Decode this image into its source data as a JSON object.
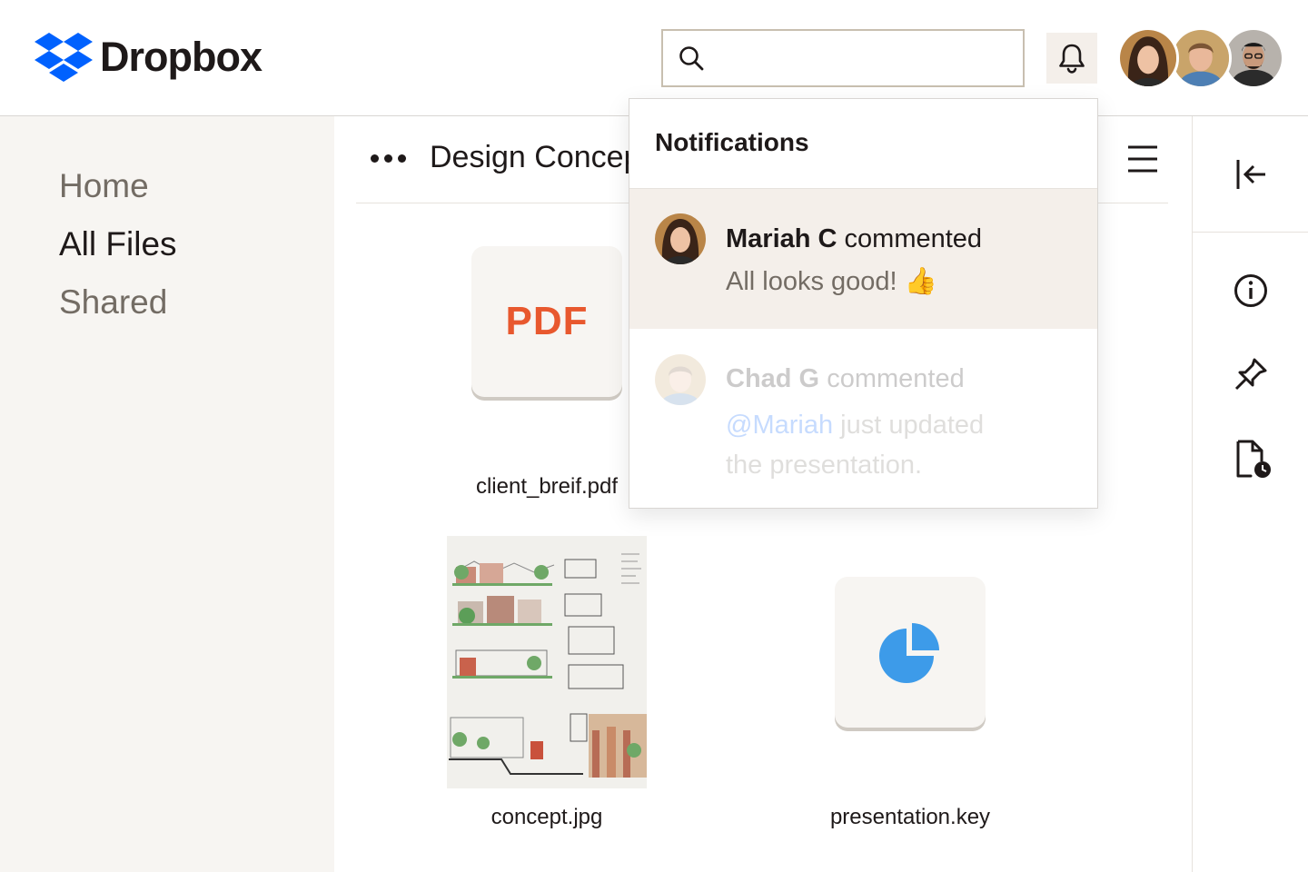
{
  "brand": {
    "name": "Dropbox",
    "color": "#0061fe"
  },
  "search": {
    "placeholder": "",
    "value": ""
  },
  "header": {
    "bell_icon": "bell-icon",
    "avatars": [
      "Mariah",
      "Chad",
      "Third user"
    ]
  },
  "sidebar": {
    "items": [
      {
        "label": "Home",
        "active": false
      },
      {
        "label": "All Files",
        "active": true
      },
      {
        "label": "Shared",
        "active": false
      }
    ]
  },
  "main": {
    "breadcrumb": "Design Concep",
    "files": [
      {
        "name": "client_breif.pdf",
        "type_label": "PDF",
        "type_color": "#e8582e"
      },
      {
        "name": "concept.jpg"
      },
      {
        "name": "presentation.key",
        "icon": "pie-chart-icon",
        "icon_color": "#3d9be9"
      }
    ]
  },
  "rail": {
    "icons": [
      "collapse-left-icon",
      "info-icon",
      "pin-icon",
      "file-activity-icon"
    ]
  },
  "notifications": {
    "title": "Notifications",
    "items": [
      {
        "name": "Mariah C",
        "action": "commented",
        "body": "All looks good! 👍"
      },
      {
        "name": "Chad G",
        "action": "commented",
        "mention": "@Mariah",
        "body": "just updated the presentation."
      }
    ]
  }
}
